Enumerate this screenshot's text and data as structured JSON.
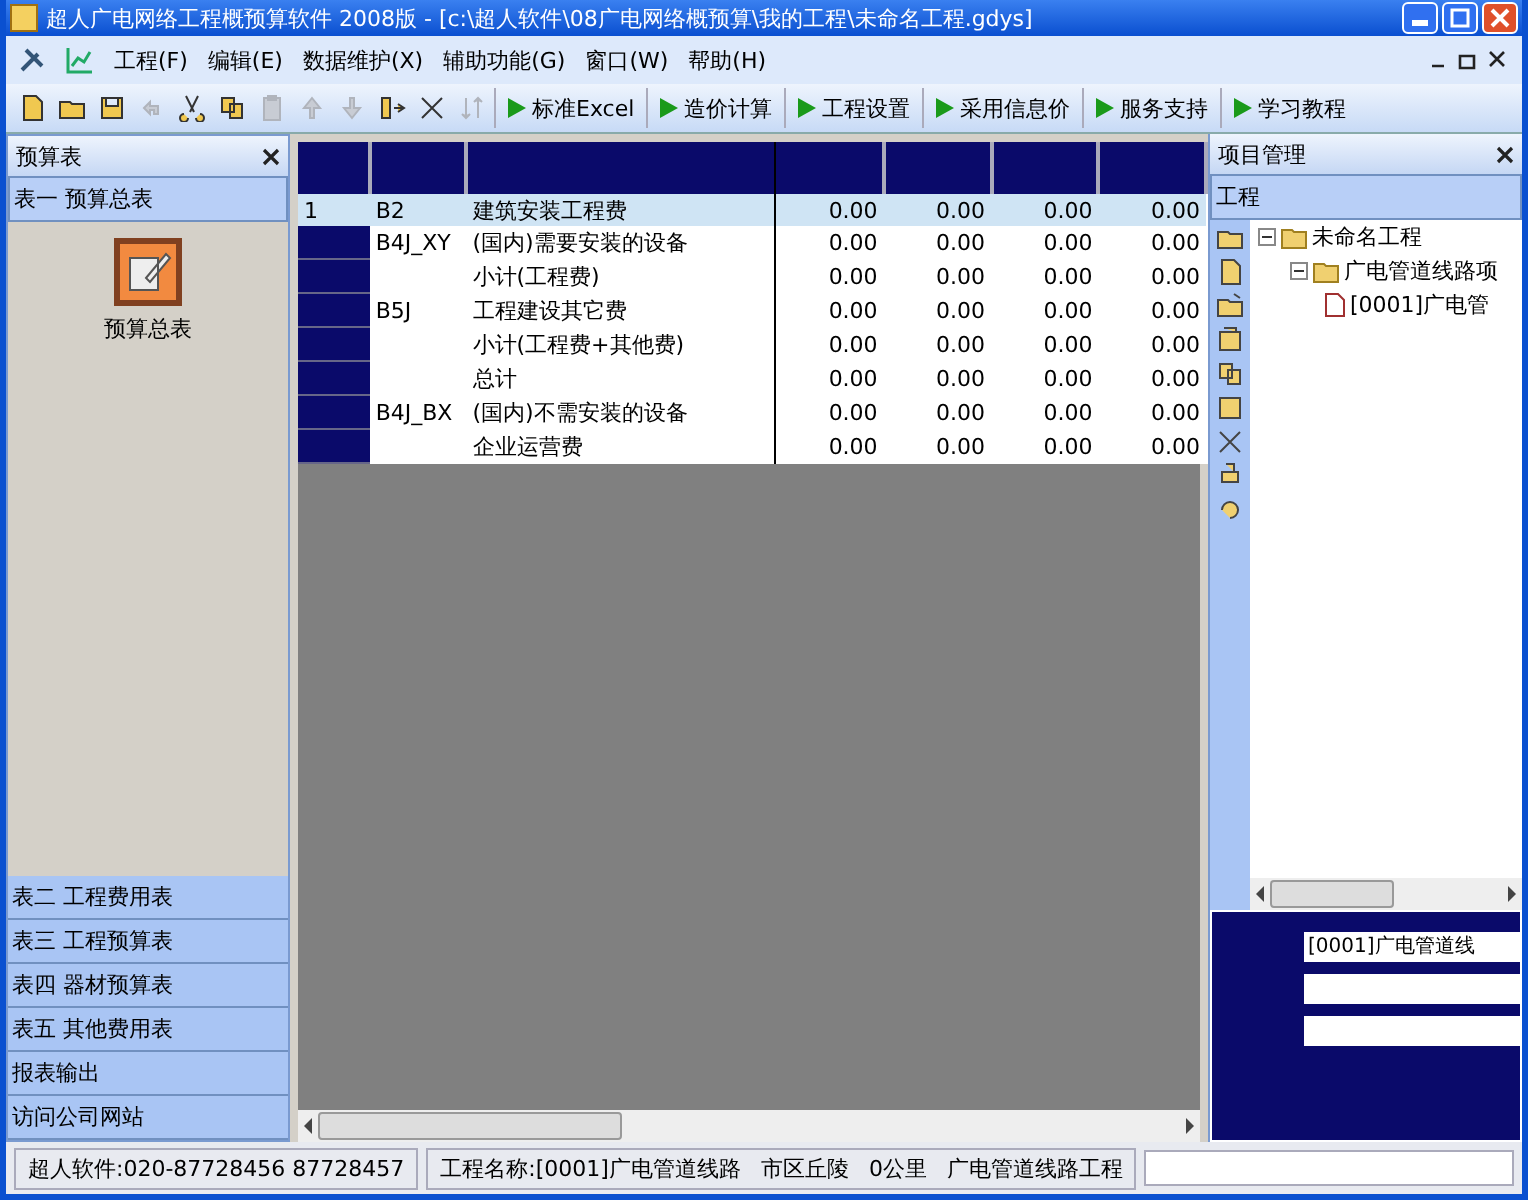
{
  "window": {
    "title": "超人广电网络工程概预算软件 2008版 - [c:\\超人软件\\08广电网络概预算\\我的工程\\未命名工程.gdys]"
  },
  "menu": [
    {
      "label": "工程(F)"
    },
    {
      "label": "编辑(E)"
    },
    {
      "label": "数据维护(X)"
    },
    {
      "label": "辅助功能(G)"
    },
    {
      "label": "窗口(W)"
    },
    {
      "label": "帮助(H)"
    }
  ],
  "toolbar": [
    {
      "kind": "icon",
      "disabled": false
    },
    {
      "kind": "icon",
      "disabled": false
    },
    {
      "kind": "icon",
      "disabled": false
    },
    {
      "kind": "icon",
      "disabled": true
    },
    {
      "kind": "icon",
      "disabled": false
    },
    {
      "kind": "icon",
      "disabled": false
    },
    {
      "kind": "icon",
      "disabled": true
    },
    {
      "kind": "icon",
      "disabled": true
    },
    {
      "kind": "icon",
      "disabled": true
    },
    {
      "kind": "icon",
      "disabled": false
    },
    {
      "kind": "icon",
      "disabled": false
    },
    {
      "kind": "icon",
      "disabled": true
    },
    {
      "kind": "labeled",
      "label": "标准Excel"
    },
    {
      "kind": "labeled",
      "label": "造价计算"
    },
    {
      "kind": "labeled",
      "label": "工程设置"
    },
    {
      "kind": "labeled",
      "label": "采用信息价"
    },
    {
      "kind": "labeled",
      "label": "服务支持"
    },
    {
      "kind": "labeled",
      "label": "学习教程"
    }
  ],
  "left_panel": {
    "title": "预算表",
    "groups": [
      {
        "label": "表一 预算总表",
        "selected": true
      }
    ],
    "content_item": "预算总表",
    "bottom_items": [
      {
        "label": "表二 工程费用表"
      },
      {
        "label": "表三 工程预算表"
      },
      {
        "label": "表四 器材预算表"
      },
      {
        "label": "表五 其他费用表"
      },
      {
        "label": "报表输出"
      },
      {
        "label": "访问公司网站"
      }
    ]
  },
  "table": {
    "rows": [
      {
        "selected": true,
        "cells": [
          "1",
          "B2",
          "建筑安装工程费",
          "0.00",
          "0.00",
          "0.00",
          "0.00"
        ]
      },
      {
        "selected": false,
        "cells": [
          "",
          "B4J_XY",
          "(国内)需要安装的设备",
          "0.00",
          "0.00",
          "0.00",
          "0.00"
        ]
      },
      {
        "selected": false,
        "cells": [
          "",
          "",
          "小计(工程费)",
          "0.00",
          "0.00",
          "0.00",
          "0.00"
        ]
      },
      {
        "selected": false,
        "cells": [
          "",
          "B5J",
          "工程建设其它费",
          "0.00",
          "0.00",
          "0.00",
          "0.00"
        ]
      },
      {
        "selected": false,
        "cells": [
          "",
          "",
          "小计(工程费+其他费)",
          "0.00",
          "0.00",
          "0.00",
          "0.00"
        ]
      },
      {
        "selected": false,
        "cells": [
          "",
          "",
          "总计",
          "0.00",
          "0.00",
          "0.00",
          "0.00"
        ]
      },
      {
        "selected": false,
        "cells": [
          "",
          "B4J_BX",
          "(国内)不需安装的设备",
          "0.00",
          "0.00",
          "0.00",
          "0.00"
        ]
      },
      {
        "selected": false,
        "cells": [
          "",
          "",
          "企业运营费",
          "0.00",
          "0.00",
          "0.00",
          "0.00"
        ]
      }
    ]
  },
  "right_panel": {
    "title": "项目管理",
    "tab": "工程",
    "tree": [
      {
        "label": "未命名工程",
        "expanded": true,
        "children": [
          {
            "label": "广电管道线路项",
            "expanded": true,
            "children": [
              {
                "label": "[0001]广电管"
              }
            ]
          }
        ]
      }
    ],
    "field_value": "[0001]广电管道线"
  },
  "status_bar": {
    "company": "超人软件:020-87728456 87728457",
    "items": [
      "工程名称:[0001]广电管道线路",
      "市区丘陵",
      "0公里",
      "广电管道线路工程"
    ]
  }
}
